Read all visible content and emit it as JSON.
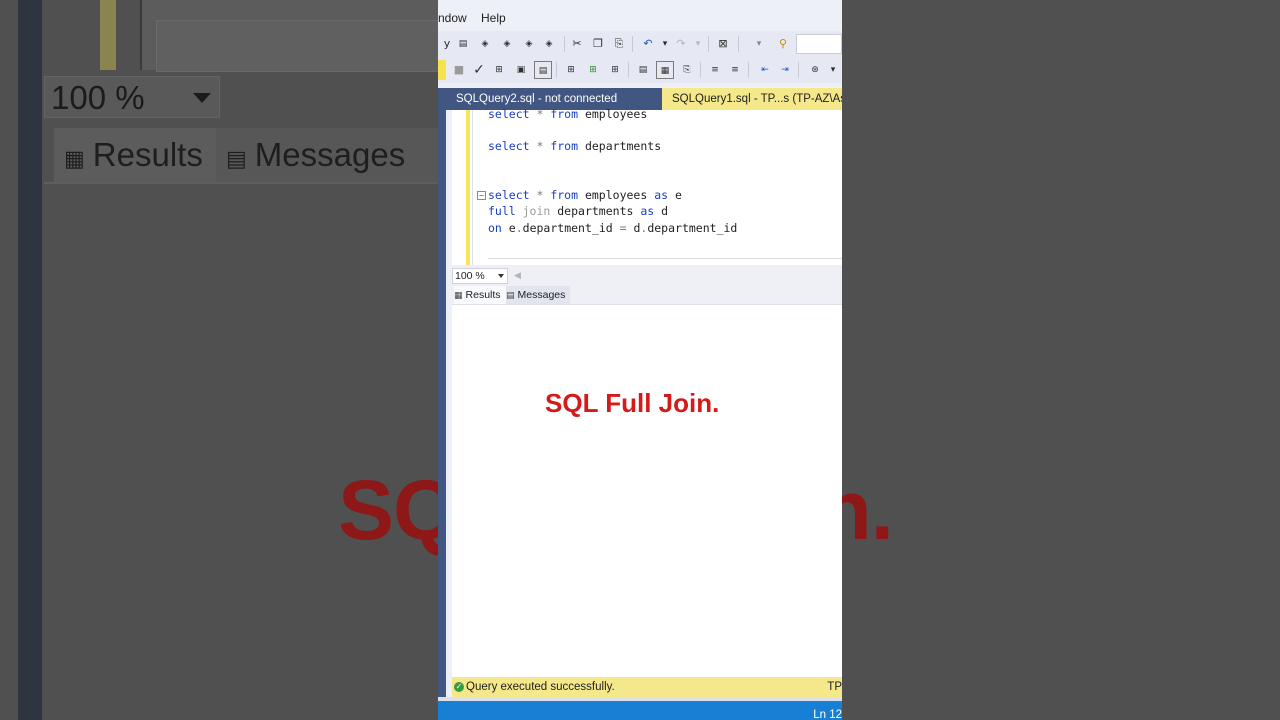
{
  "background": {
    "zoom_value": "100 %",
    "results_tab": "Results",
    "messages_tab": "Messages",
    "big_text_left": "SQ",
    "big_text_right": "in."
  },
  "menu": {
    "window": "ndow",
    "help": "Help"
  },
  "toolbar": {
    "icons_row1": [
      "y",
      "query-mdx-icon",
      "query-dmx-icon",
      "query-xmla-icon",
      "query-das-icon",
      "cut-icon",
      "copy-icon",
      "paste-icon",
      "undo-icon",
      "redo-icon",
      "solution-explorer-icon",
      "find-icon"
    ],
    "icons_row2": [
      "stop-icon",
      "parse-check-icon",
      "display-plan-icon",
      "query-options-icon",
      "intellisense-icon",
      "results-to-text-icon",
      "results-to-grid-icon",
      "results-to-file-icon",
      "comment-icon",
      "uncomment-icon",
      "decrease-indent-icon",
      "increase-indent-icon",
      "specify-values-icon"
    ]
  },
  "tabs": {
    "inactive": "SQLQuery2.sql - not connected",
    "active": "SQLQuery1.sql - TP...s (TP-AZ\\Asad"
  },
  "code": {
    "line1_kw": "select",
    "line1_op": " * ",
    "line1_from": "from",
    "line1_rest": " employees",
    "line2_kw": "select",
    "line2_op": " * ",
    "line2_from": "from",
    "line2_rest": " departments",
    "line3_kw": "select",
    "line3_op": " * ",
    "line3_from": "from",
    "line3_rest": " employees ",
    "line3_as": "as",
    "line3_alias": " e",
    "line4_full": "full",
    "line4_join": " join",
    "line4_rest": " departments ",
    "line4_as": "as",
    "line4_alias": " d",
    "line5_on": "on",
    "line5_rest1": " e",
    "line5_dot1": ".",
    "line5_rest2": "department_id ",
    "line5_eq": "=",
    "line5_rest3": " d",
    "line5_dot2": ".",
    "line5_rest4": "department_id"
  },
  "zoom": {
    "value": "100 %"
  },
  "result_tabs": {
    "results": "Results",
    "messages": "Messages"
  },
  "status": {
    "message": "Query executed successfully.",
    "server": "TP"
  },
  "bottom": {
    "line": "Ln 12"
  },
  "overlay": {
    "title": "SQL Full Join."
  },
  "colors": {
    "accent_red": "#d51a1a",
    "tab_active": "#f5e88a",
    "tab_strip": "#415680",
    "status_blue": "#1780d4",
    "keyword_blue": "#1a3fbf"
  }
}
